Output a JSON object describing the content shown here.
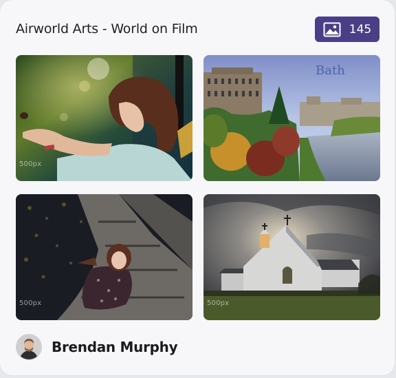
{
  "header": {
    "title": "Airworld Arts - World on Film",
    "photo_count": "145",
    "badge_icon": "image-gallery-icon",
    "badge_color": "#4a3f86"
  },
  "photos": [
    {
      "name": "child-feeding-bird",
      "watermark": "500px",
      "caption": ""
    },
    {
      "name": "bath-river-view",
      "watermark": "",
      "caption": "Bath"
    },
    {
      "name": "woman-on-stone-steps",
      "watermark": "500px",
      "caption": ""
    },
    {
      "name": "white-church-stormy-sky",
      "watermark": "500px",
      "caption": ""
    }
  ],
  "author": {
    "name": "Brendan Murphy",
    "avatar_icon": "user-avatar-icon"
  }
}
